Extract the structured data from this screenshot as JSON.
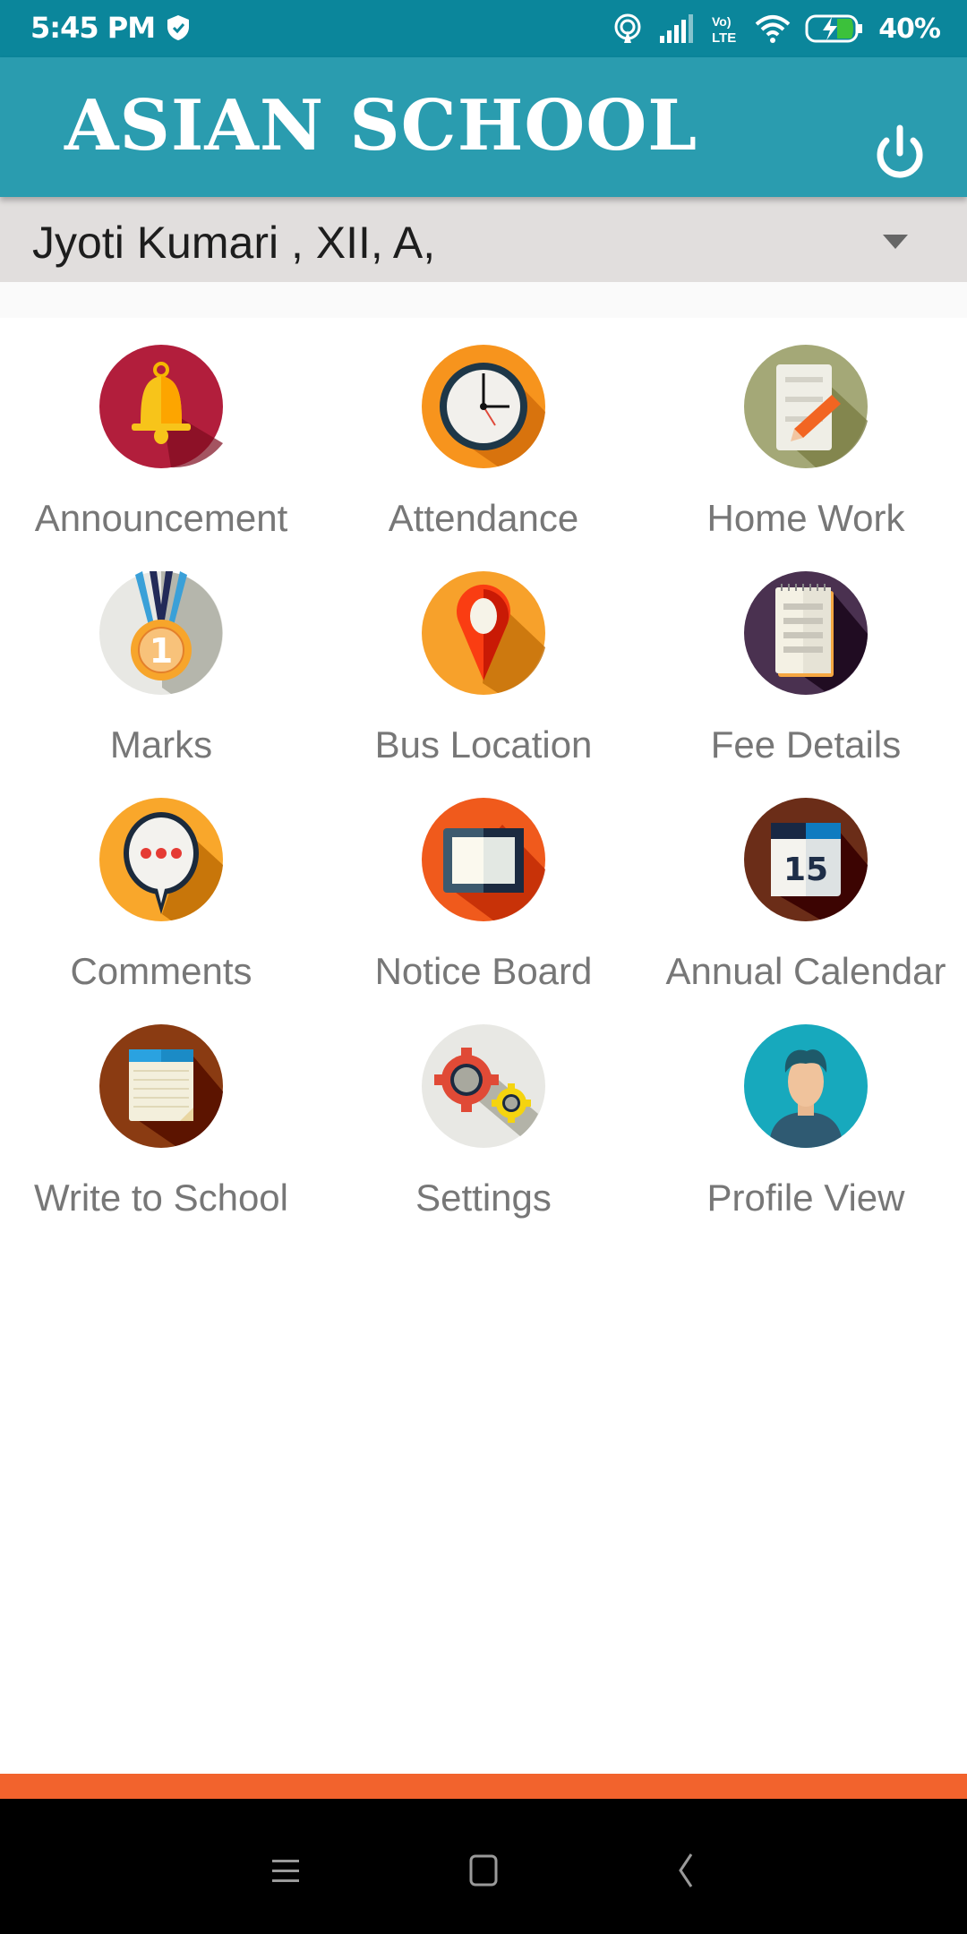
{
  "status_bar": {
    "time": "5:45 PM",
    "battery_percent": "40%",
    "network": "VoLTE",
    "icons": [
      "shield-check-icon",
      "hotspot-icon",
      "signal-icon",
      "volte-icon",
      "wifi-icon",
      "battery-charging-icon"
    ]
  },
  "toolbar": {
    "title": "ASIAN SCHOOL",
    "power_icon": "power-icon"
  },
  "student_selector": {
    "selected": "Jyoti Kumari , XII, A,"
  },
  "menu": {
    "items": [
      {
        "label": "Announcement",
        "icon": "bell-icon",
        "color": "#b21e3c"
      },
      {
        "label": "Attendance",
        "icon": "clock-icon",
        "color": "#f7941d"
      },
      {
        "label": "Home Work",
        "icon": "homework-icon",
        "color": "#a4a877"
      },
      {
        "label": "Marks",
        "icon": "medal-icon",
        "color": "#e8e8e4"
      },
      {
        "label": "Bus Location",
        "icon": "location-pin-icon",
        "color": "#f7a12b"
      },
      {
        "label": "Fee Details",
        "icon": "notepad-icon",
        "color": "#4a3150"
      },
      {
        "label": "Comments",
        "icon": "chat-bubble-icon",
        "color": "#f9a72b"
      },
      {
        "label": "Notice Board",
        "icon": "board-icon",
        "color": "#f05a1c"
      },
      {
        "label": "Annual Calendar",
        "icon": "calendar-icon",
        "color": "#6b2d18"
      },
      {
        "label": "Write to School",
        "icon": "note-icon",
        "color": "#8a3b12"
      },
      {
        "label": "Settings",
        "icon": "gears-icon",
        "color": "#e8e8e4"
      },
      {
        "label": "Profile View",
        "icon": "user-avatar-icon",
        "color": "#17a9bd"
      }
    ],
    "calendar_day": "15",
    "medal_rank": "1"
  },
  "accent_bar_color": "#f2632d",
  "nav_bar": {
    "buttons": [
      "menu-icon",
      "home-icon",
      "back-icon"
    ]
  }
}
